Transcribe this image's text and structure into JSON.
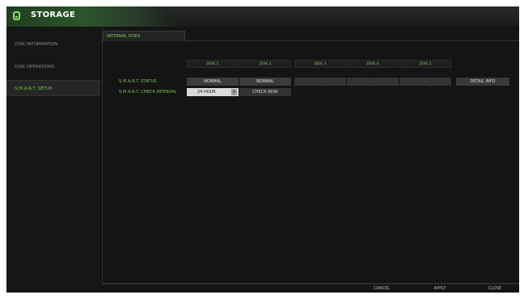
{
  "window": {
    "title": "STORAGE",
    "icon": "storage-icon"
  },
  "sidebar": {
    "items": [
      {
        "label": "DISK INFORMATION",
        "active": false
      },
      {
        "label": "DISK OPERATIONS",
        "active": false
      },
      {
        "label": "S.M.A.R.T. SETUP",
        "active": true
      }
    ]
  },
  "tabs": [
    {
      "label": "INTERNAL DISKS",
      "active": true
    }
  ],
  "table": {
    "columns": [
      "DISK 1",
      "DISK 2",
      "DISK 3",
      "DISK 4",
      "DISK 5"
    ],
    "status_label": "S.M.A.R.T. STATUS",
    "status_values": [
      "NORMAL",
      "NORMAL",
      "-",
      "-",
      "-"
    ],
    "interval_label": "S.M.A.R.T. CHECK INTERVAL",
    "interval_value": "24 HOUR",
    "check_now": "CHECK NOW",
    "detail_info": "DETAIL INFO"
  },
  "footer": {
    "cancel": "CANCEL",
    "apply": "APPLY",
    "close": "CLOSE"
  },
  "colors": {
    "accent": "#76c94e",
    "background": "#141414",
    "cell": "#3c3c3c"
  }
}
